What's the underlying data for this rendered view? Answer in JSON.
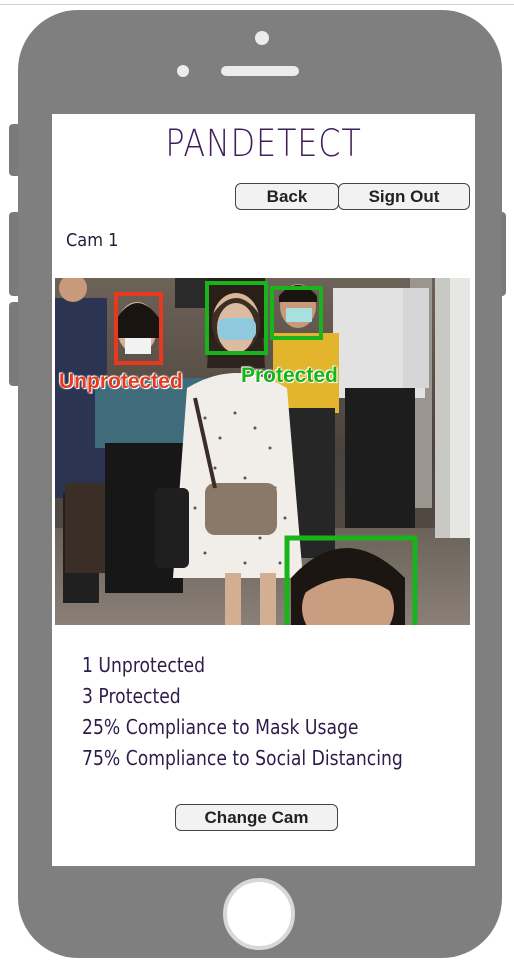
{
  "app": {
    "title": "PANDETECT"
  },
  "header": {
    "back_label": "Back",
    "signout_label": "Sign Out"
  },
  "camera": {
    "label": "Cam 1"
  },
  "detections": [
    {
      "label": "Unprotected",
      "color": "#e8391e"
    },
    {
      "label": "Protected",
      "color": "#18b41a"
    }
  ],
  "stats": {
    "items": [
      "1 Unprotected",
      "3 Protected",
      "25% Compliance to Mask Usage",
      "75% Compliance to Social Distancing"
    ]
  },
  "footer": {
    "change_cam_label": "Change Cam"
  },
  "colors": {
    "phone_body": "#7f7f7f",
    "title_text": "#3f1e5a",
    "unprotected_box": "#e8391e",
    "protected_box": "#18b41a"
  }
}
